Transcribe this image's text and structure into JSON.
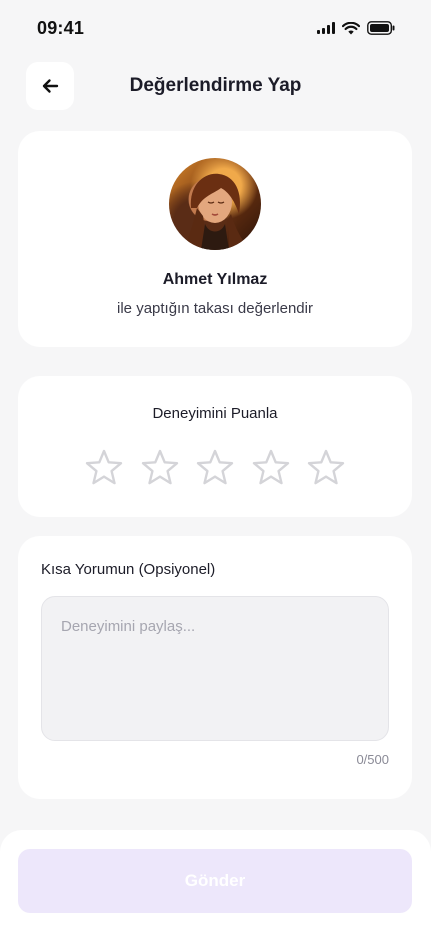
{
  "status_bar": {
    "time": "09:41",
    "icons": [
      "signal-icon",
      "wifi-icon",
      "battery-icon"
    ]
  },
  "header": {
    "back_icon": "arrow-left-icon",
    "title": "Değerlendirme Yap"
  },
  "profile": {
    "name": "Ahmet Yılmaz",
    "subtitle": "ile yaptığın takası değerlendir"
  },
  "rating": {
    "title": "Deneyimini Puanla",
    "max_stars": 5,
    "selected": 0,
    "star_color": "#d4d4d8"
  },
  "comment": {
    "label": "Kısa Yorumun (Opsiyonel)",
    "value": "",
    "placeholder": "Deneyimini paylaş...",
    "counter": "0/500"
  },
  "submit": {
    "label": "Gönder",
    "disabled": true,
    "bg_color": "#ede7fb"
  }
}
